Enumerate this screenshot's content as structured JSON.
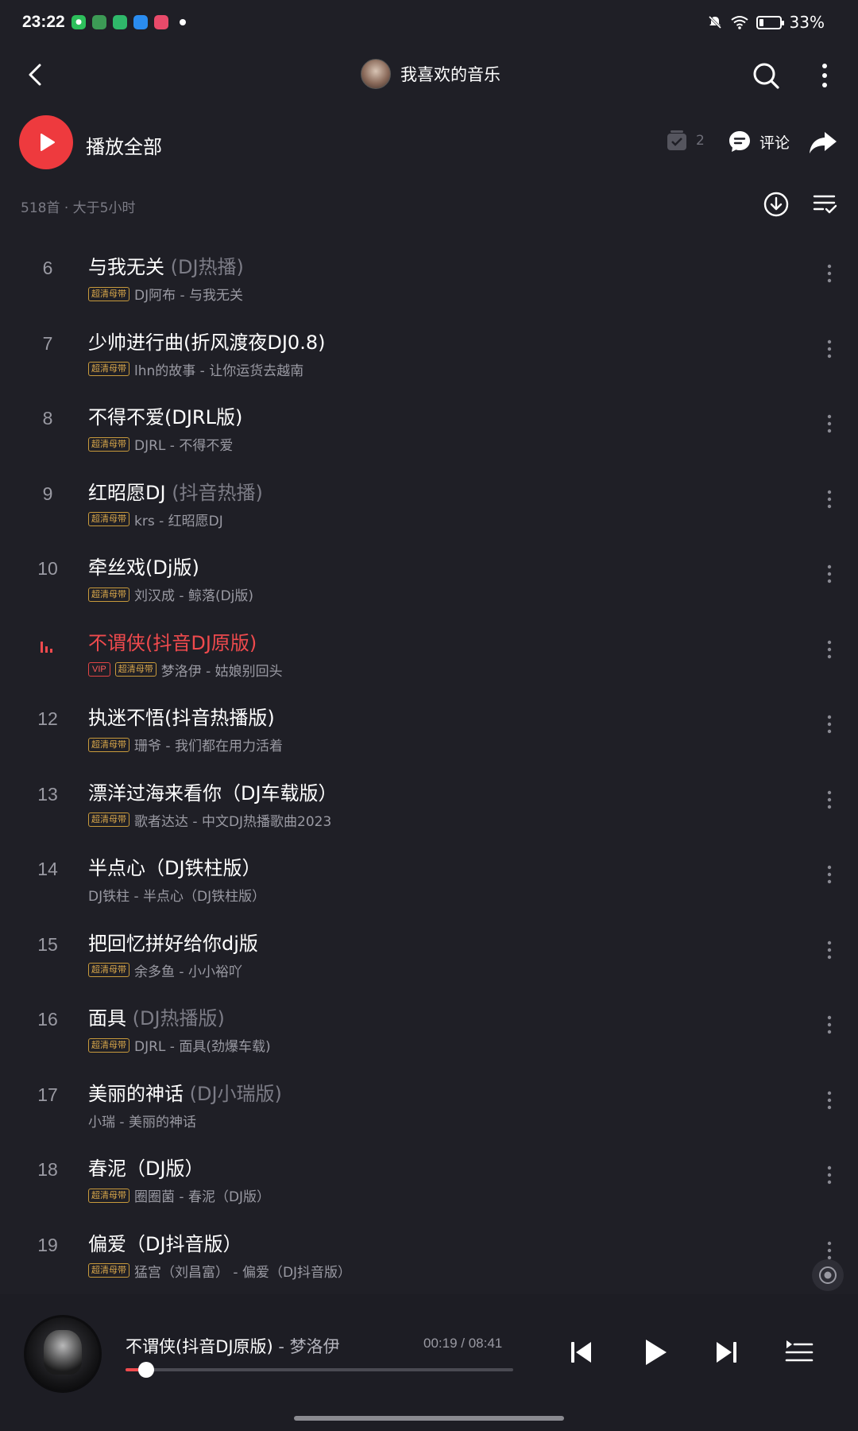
{
  "status_bar": {
    "time": "23:22",
    "battery_percent": "33%",
    "battery_level": 0.33
  },
  "header": {
    "title": "我喜欢的音乐"
  },
  "actions": {
    "play_all_label": "播放全部",
    "checkbox_count": "2",
    "comment_label": "评论"
  },
  "playlist_info": "518首 · 大于5小时",
  "songs": [
    {
      "index": "6",
      "title": "与我无关",
      "suffix": " (DJ热播)",
      "tags": [
        "超清母带"
      ],
      "meta": "DJ阿布 - 与我无关"
    },
    {
      "index": "7",
      "title": "少帅进行曲(折风渡夜DJ0.8)",
      "suffix": "",
      "tags": [
        "超清母带"
      ],
      "meta": "lhn的故事 - 让你运货去越南"
    },
    {
      "index": "8",
      "title": "不得不爱(DJRL版)",
      "suffix": "",
      "tags": [
        "超清母带"
      ],
      "meta": "DJRL - 不得不爱"
    },
    {
      "index": "9",
      "title": "红昭愿DJ",
      "suffix": " (抖音热播)",
      "tags": [
        "超清母带"
      ],
      "meta": "krs - 红昭愿DJ"
    },
    {
      "index": "10",
      "title": "牵丝戏(Dj版)",
      "suffix": "",
      "tags": [
        "超清母带"
      ],
      "meta": "刘汉成 - 鲸落(Dj版)"
    },
    {
      "index": "",
      "title": "不谓侠(抖音DJ原版)",
      "suffix": "",
      "tags": [
        "VIP",
        "超清母带"
      ],
      "meta": "梦洛伊 - 姑娘别回头",
      "playing": true
    },
    {
      "index": "12",
      "title": "执迷不悟(抖音热播版)",
      "suffix": "",
      "tags": [
        "超清母带"
      ],
      "meta": "珊爷 - 我们都在用力活着"
    },
    {
      "index": "13",
      "title": "漂洋过海来看你（DJ车载版）",
      "suffix": "",
      "tags": [
        "超清母带"
      ],
      "meta": "歌者达达 - 中文DJ热播歌曲2023"
    },
    {
      "index": "14",
      "title": "半点心（DJ铁柱版）",
      "suffix": "",
      "tags": [],
      "meta": "DJ铁柱 - 半点心（DJ铁柱版）"
    },
    {
      "index": "15",
      "title": "把回忆拼好给你dj版",
      "suffix": "",
      "tags": [
        "超清母带"
      ],
      "meta": "余多鱼 - 小小裕吖"
    },
    {
      "index": "16",
      "title": "面具",
      "suffix": " (DJ热播版)",
      "tags": [
        "超清母带"
      ],
      "meta": "DJRL - 面具(劲爆车载)"
    },
    {
      "index": "17",
      "title": "美丽的神话",
      "suffix": " (DJ小瑞版)",
      "tags": [],
      "meta": "小瑞 - 美丽的神话"
    },
    {
      "index": "18",
      "title": "春泥（DJ版）",
      "suffix": "",
      "tags": [
        "超清母带"
      ],
      "meta": "圈圈菌 - 春泥（DJ版）"
    },
    {
      "index": "19",
      "title": "偏爱（DJ抖音版）",
      "suffix": "",
      "tags": [
        "超清母带"
      ],
      "meta": "猛宫（刘昌富） - 偏爱（DJ抖音版）"
    }
  ],
  "player": {
    "title": "不谓侠(抖音DJ原版)",
    "artist": " - 梦洛伊",
    "time": "00:19 / 08:41",
    "progress": 0.054
  },
  "colors": {
    "background": "#1f1f26",
    "accent": "#ee3a3e",
    "hq_tag": "#d7a64a"
  },
  "icons": [
    "back-icon",
    "search-icon",
    "more-icon",
    "play-icon",
    "checkbox-icon",
    "comment-icon",
    "share-icon",
    "download-icon",
    "multiselect-icon",
    "playing-bars-icon",
    "locate-icon",
    "prev-icon",
    "next-icon",
    "queue-icon"
  ]
}
